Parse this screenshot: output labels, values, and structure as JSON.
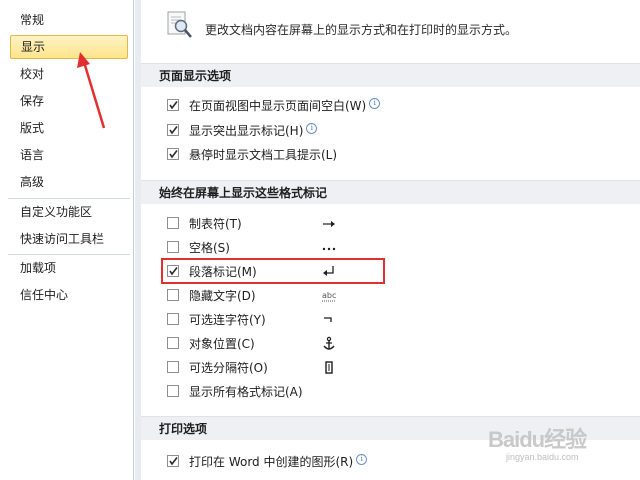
{
  "sidebar": {
    "items": [
      {
        "label": "常规",
        "active": false
      },
      {
        "label": "显示",
        "active": true
      },
      {
        "label": "校对",
        "active": false
      },
      {
        "label": "保存",
        "active": false
      },
      {
        "label": "版式",
        "active": false
      },
      {
        "label": "语言",
        "active": false
      },
      {
        "label": "高级",
        "active": false
      },
      {
        "label": "自定义功能区",
        "active": false
      },
      {
        "label": "快速访问工具栏",
        "active": false
      },
      {
        "label": "加载项",
        "active": false
      },
      {
        "label": "信任中心",
        "active": false
      }
    ]
  },
  "header": {
    "description": "更改文档内容在屏幕上的显示方式和在打印时的显示方式。",
    "icon": "document-magnifier-icon"
  },
  "sections": {
    "page_display": {
      "title": "页面显示选项",
      "options": [
        {
          "label": "在页面视图中显示页面间空白(W)",
          "checked": true,
          "info": true
        },
        {
          "label": "显示突出显示标记(H)",
          "checked": true,
          "info": true
        },
        {
          "label": "悬停时显示文档工具提示(L)",
          "checked": true,
          "info": false
        }
      ]
    },
    "format_marks": {
      "title": "始终在屏幕上显示这些格式标记",
      "options": [
        {
          "label": "制表符(T)",
          "checked": false,
          "mark": "→",
          "mark_icon": "tab-arrow-icon"
        },
        {
          "label": "空格(S)",
          "checked": false,
          "mark": "···",
          "mark_icon": "space-dots-icon"
        },
        {
          "label": "段落标记(M)",
          "checked": true,
          "mark": "↵",
          "mark_icon": "paragraph-mark-icon"
        },
        {
          "label": "隐藏文字(D)",
          "checked": false,
          "mark": "abc",
          "mark_icon": "hidden-text-icon"
        },
        {
          "label": "可选连字符(Y)",
          "checked": false,
          "mark": "¬",
          "mark_icon": "optional-hyphen-icon"
        },
        {
          "label": "对象位置(C)",
          "checked": false,
          "mark": "⚓",
          "mark_icon": "anchor-icon"
        },
        {
          "label": "可选分隔符(O)",
          "checked": false,
          "mark": "▯",
          "mark_icon": "separator-icon"
        },
        {
          "label": "显示所有格式标记(A)",
          "checked": false,
          "mark": "",
          "mark_icon": ""
        }
      ]
    },
    "print": {
      "title": "打印选项",
      "options": [
        {
          "label": "打印在 Word 中创建的图形(R)",
          "checked": true,
          "info": true
        }
      ]
    }
  },
  "watermark": {
    "brand": "Baidu经验",
    "url": "jingyan.baidu.com"
  },
  "colors": {
    "active_nav_bg": "#fde48a",
    "highlight_border": "#e23030",
    "arrow": "#e23030",
    "section_bg": "#eef0f3"
  }
}
